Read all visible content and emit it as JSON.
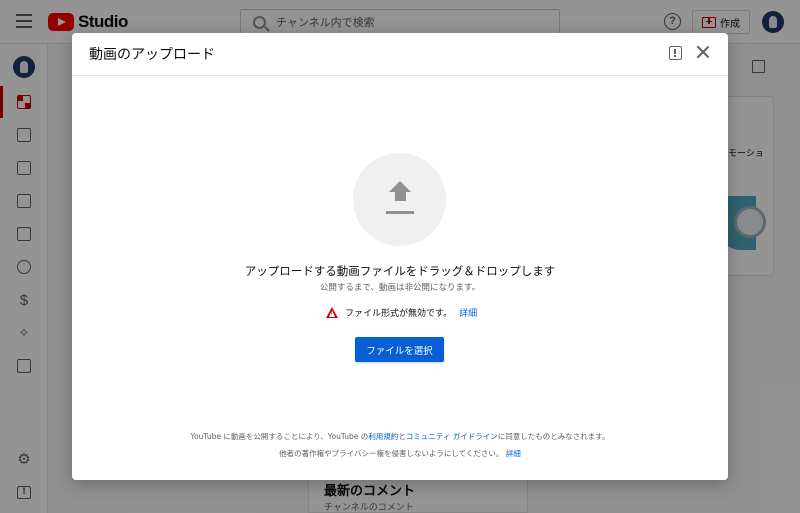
{
  "app": {
    "logo_text": "Studio",
    "search_placeholder": "チャンネル内で検索",
    "create_label": "作成"
  },
  "background": {
    "right_card_text": "モーショ",
    "bottom_card_title": "最新のコメント",
    "bottom_card_sub": "チャンネルのコメント"
  },
  "dialog": {
    "title": "動画のアップロード",
    "drop_title": "アップロードする動画ファイルをドラッグ＆ドロップします",
    "drop_subtitle": "公開するまで、動画は非公開になります。",
    "error_text": "ファイル形式が無効です。",
    "error_link": "詳細",
    "select_button": "ファイルを選択",
    "legal": {
      "line1_prefix": "YouTube に動画を公開することにより、YouTube の",
      "terms_link": "利用規約",
      "and": "と",
      "guidelines_link": "コミュニティ ガイドライン",
      "line1_suffix": "に同意したものとみなされます。",
      "line2": "他者の著作権やプライバシー権を侵害しないようにしてください。",
      "line2_link": "詳細"
    }
  },
  "colors": {
    "accent": "#065fd4",
    "brand": "#ff0000",
    "error": "#cc0000"
  },
  "icons": [
    "menu-icon",
    "youtube-logo-icon",
    "search-icon",
    "help-icon",
    "create-video-icon",
    "avatar",
    "dashboard-icon",
    "content-icon",
    "analytics-icon",
    "comments-icon",
    "subtitles-icon",
    "copyright-icon",
    "earn-icon",
    "customization-icon",
    "audio-library-icon",
    "settings-icon",
    "send-feedback-icon",
    "feedback-icon",
    "close-icon",
    "upload-icon",
    "warning-icon"
  ]
}
